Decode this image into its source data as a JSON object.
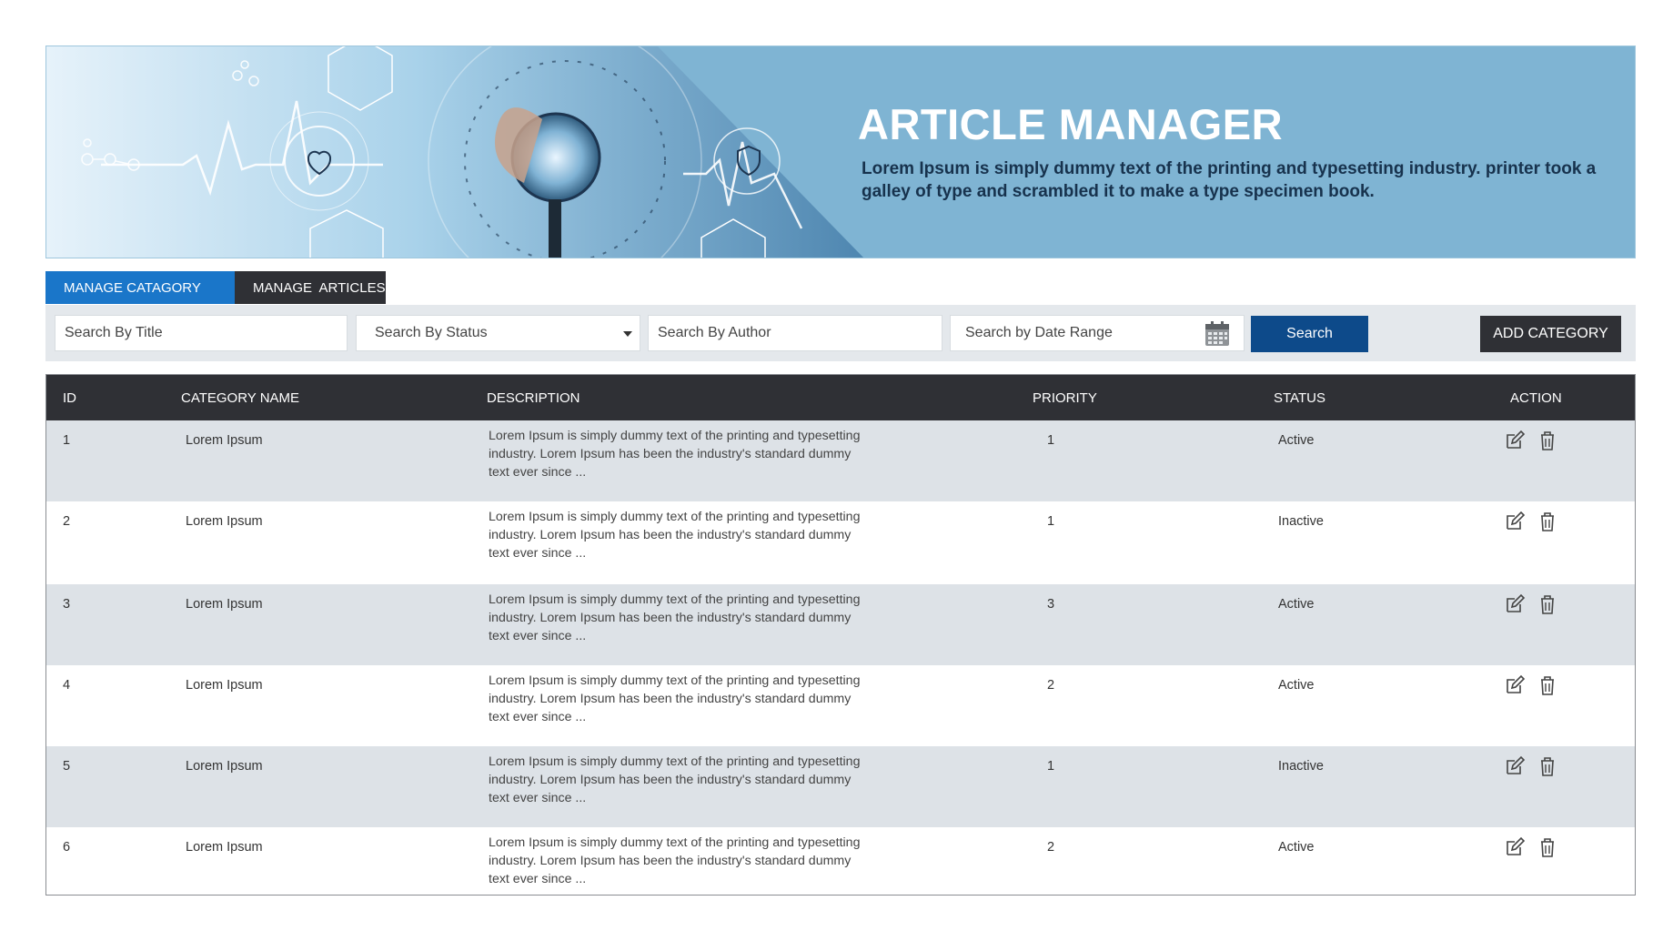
{
  "banner": {
    "title": "ARTICLE MANAGER",
    "subtitle": "Lorem Ipsum is simply dummy text of the printing and typesetting industry. printer took a galley of type and scrambled it to make a type specimen book."
  },
  "tabs": [
    {
      "label": "MANAGE CATAGORY",
      "active": true
    },
    {
      "label": "MANAGE  ARTICLES",
      "active": false
    }
  ],
  "filters": {
    "title_placeholder": "Search By Title",
    "status_placeholder": "Search By Status",
    "author_placeholder": "Search By Author",
    "date_placeholder": "Search by Date Range",
    "search_label": "Search",
    "add_label": "ADD CATEGORY"
  },
  "table": {
    "headers": [
      "ID",
      "CATEGORY NAME",
      "DESCRIPTION",
      "PRIORITY",
      "STATUS",
      "ACTION"
    ],
    "rows": [
      {
        "id": "1",
        "name": "Lorem Ipsum",
        "desc_lines": [
          "Lorem Ipsum is simply dummy text of the printing and typesetting",
          "industry. Lorem Ipsum has been the industry's standard dummy",
          "text ever since ..."
        ],
        "priority": "1",
        "status": "Active"
      },
      {
        "id": "2",
        "name": "Lorem Ipsum",
        "desc_lines": [
          "Lorem Ipsum is simply dummy text of the printing and typesetting",
          "industry. Lorem Ipsum has been the industry's standard dummy",
          "text ever since ..."
        ],
        "priority": "1",
        "status": "Inactive"
      },
      {
        "id": "3",
        "name": "Lorem Ipsum",
        "desc_lines": [
          "Lorem Ipsum is simply dummy text of the printing and typesetting",
          "industry. Lorem Ipsum has been the industry's standard dummy",
          "text ever since ..."
        ],
        "priority": "3",
        "status": "Active"
      },
      {
        "id": "4",
        "name": "Lorem Ipsum",
        "desc_lines": [
          "Lorem Ipsum is simply dummy text of the printing and typesetting",
          "industry. Lorem Ipsum has been the industry's standard dummy",
          "text ever since ..."
        ],
        "priority": "2",
        "status": "Active"
      },
      {
        "id": "5",
        "name": "Lorem Ipsum",
        "desc_lines": [
          "Lorem Ipsum is simply dummy text of the printing and typesetting",
          "industry. Lorem Ipsum has been the industry's standard dummy",
          "text ever since ..."
        ],
        "priority": "1",
        "status": "Inactive"
      },
      {
        "id": "6",
        "name": "Lorem Ipsum",
        "desc_lines": [
          "Lorem Ipsum is simply dummy text of the printing and typesetting",
          "industry. Lorem Ipsum has been the industry's standard dummy",
          "text ever since ..."
        ],
        "priority": "2",
        "status": "Active"
      }
    ],
    "row_actions": [
      "edit-icon",
      "delete-icon"
    ]
  },
  "colors": {
    "banner_bg": "#7fb4d3",
    "tab_active": "#1a76c9",
    "tab_inactive": "#2f3035",
    "search_button": "#0d4a8a",
    "header_bg": "#2f3035",
    "row_alt": "#dde2e7"
  }
}
